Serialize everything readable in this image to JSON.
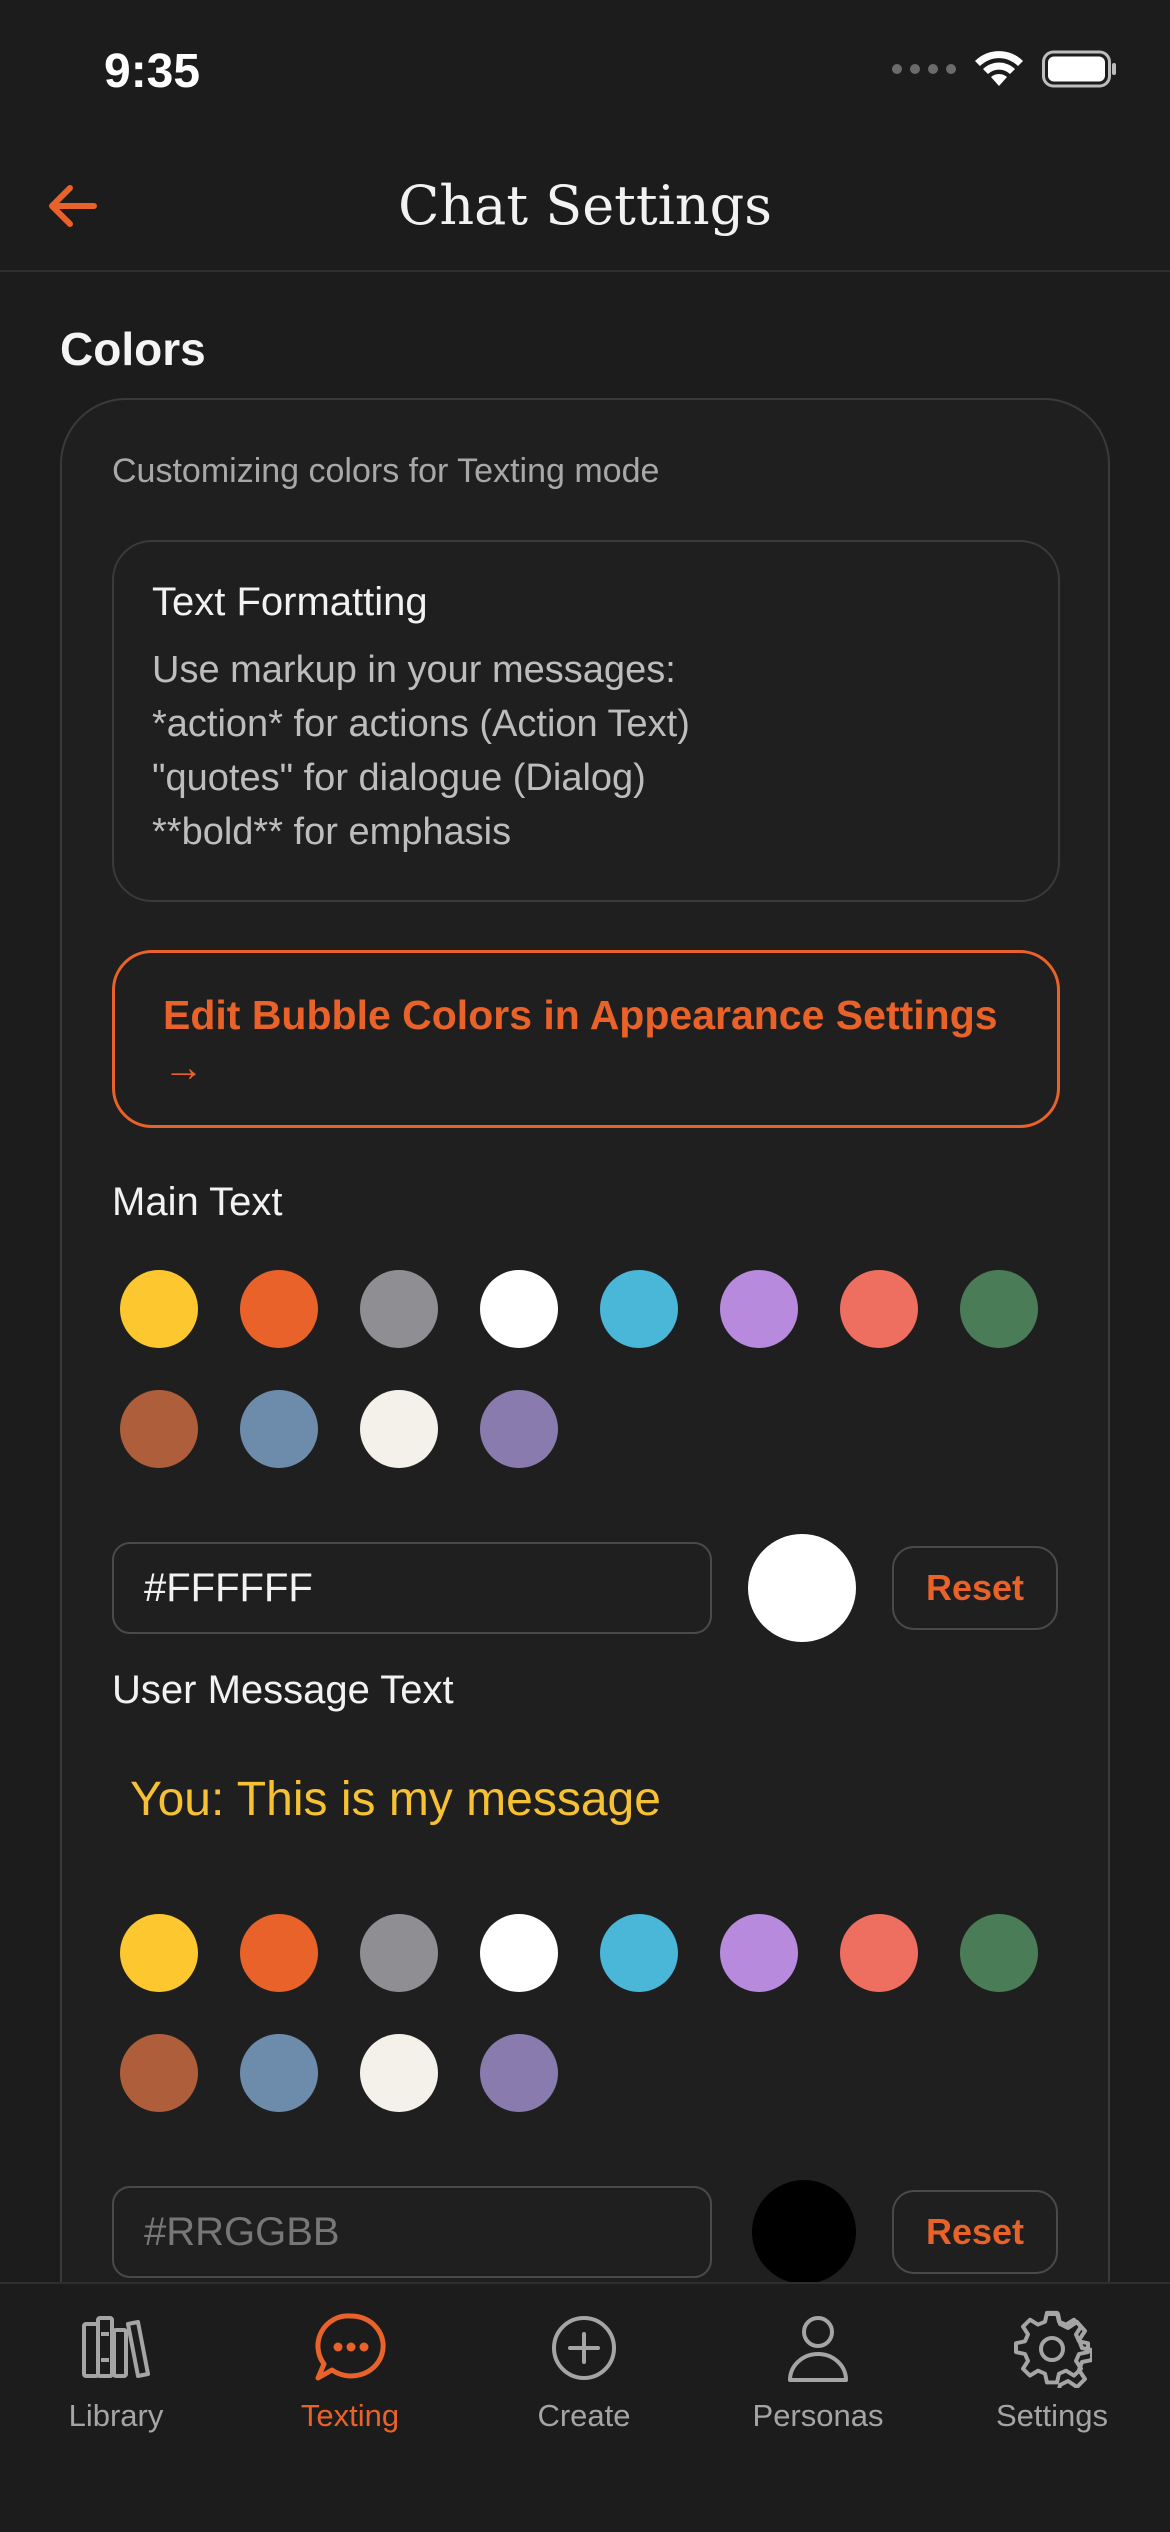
{
  "status_bar": {
    "time": "9:35"
  },
  "nav": {
    "title": "Chat Settings"
  },
  "section": {
    "title": "Colors"
  },
  "card": {
    "subtitle": "Customizing colors for Texting mode",
    "formatting": {
      "title": "Text Formatting",
      "lines": [
        "Use markup in your messages:",
        "*action* for actions (Action Text)",
        "\"quotes\" for dialogue (Dialog)",
        "**bold** for emphasis"
      ]
    },
    "edit_bubble_label": "Edit Bubble Colors in Appearance Settings →"
  },
  "palette": [
    "#fdc82f",
    "#e8622a",
    "#8e8e93",
    "#ffffff",
    "#4ab6d8",
    "#b88ade",
    "#ee6e60",
    "#4a7d57",
    "#ae5e3a",
    "#6d8cab",
    "#f4f1ea",
    "#8a7baf"
  ],
  "main_text": {
    "label": "Main Text",
    "hex_value": "#FFFFFF",
    "preview_color": "#ffffff",
    "reset_label": "Reset"
  },
  "user_message_text": {
    "label": "User Message Text",
    "preview": "You: This is my message",
    "preview_color": "#f6c234",
    "hex_placeholder": "#RRGGBB",
    "color_preview": "#000000",
    "reset_label": "Reset"
  },
  "tabs": [
    {
      "label": "Library",
      "icon": "library-icon",
      "active": false
    },
    {
      "label": "Texting",
      "icon": "chat-bubble-icon",
      "active": true
    },
    {
      "label": "Create",
      "icon": "plus-circle-icon",
      "active": false
    },
    {
      "label": "Personas",
      "icon": "person-icon",
      "active": false
    },
    {
      "label": "Settings",
      "icon": "gear-icon",
      "active": false
    }
  ],
  "colors": {
    "accent": "#e8622a",
    "background": "#1c1c1c"
  }
}
